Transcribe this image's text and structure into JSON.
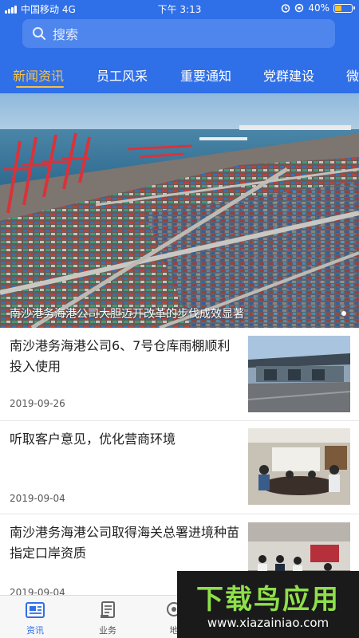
{
  "status": {
    "carrier": "中国移动 4G",
    "time": "下午 3:13",
    "battery": "40%",
    "battery_level": 0.4
  },
  "search": {
    "placeholder": "搜索"
  },
  "tabs": [
    {
      "label": "新闻资讯",
      "active": true
    },
    {
      "label": "员工风采"
    },
    {
      "label": "重要通知"
    },
    {
      "label": "党群建设"
    },
    {
      "label": "微"
    }
  ],
  "banner": {
    "caption": "南沙港务海港公司大胆迈开改革的步伐成效显著"
  },
  "news": [
    {
      "title": "南沙港务海港公司6、7号仓库雨棚顺利投入使用",
      "date": "2019-09-26"
    },
    {
      "title": "听取客户意见，优化营商环境",
      "date": "2019-09-04"
    },
    {
      "title": "南沙港务海港公司取得海关总署进境种苗指定口岸资质",
      "date": "2019-09-04"
    }
  ],
  "bottom_nav": [
    {
      "label": "资讯",
      "icon": "news-icon",
      "active": true
    },
    {
      "label": "业务",
      "icon": "document-icon"
    },
    {
      "label": "地",
      "icon": "map-icon"
    }
  ],
  "watermark": {
    "title": "下载鸟应用",
    "url": "www.xiazainiao.com"
  },
  "colors": {
    "header": "#2f6fe8",
    "active_tab": "#f3c24c",
    "watermark_green": "#8ee04a"
  }
}
